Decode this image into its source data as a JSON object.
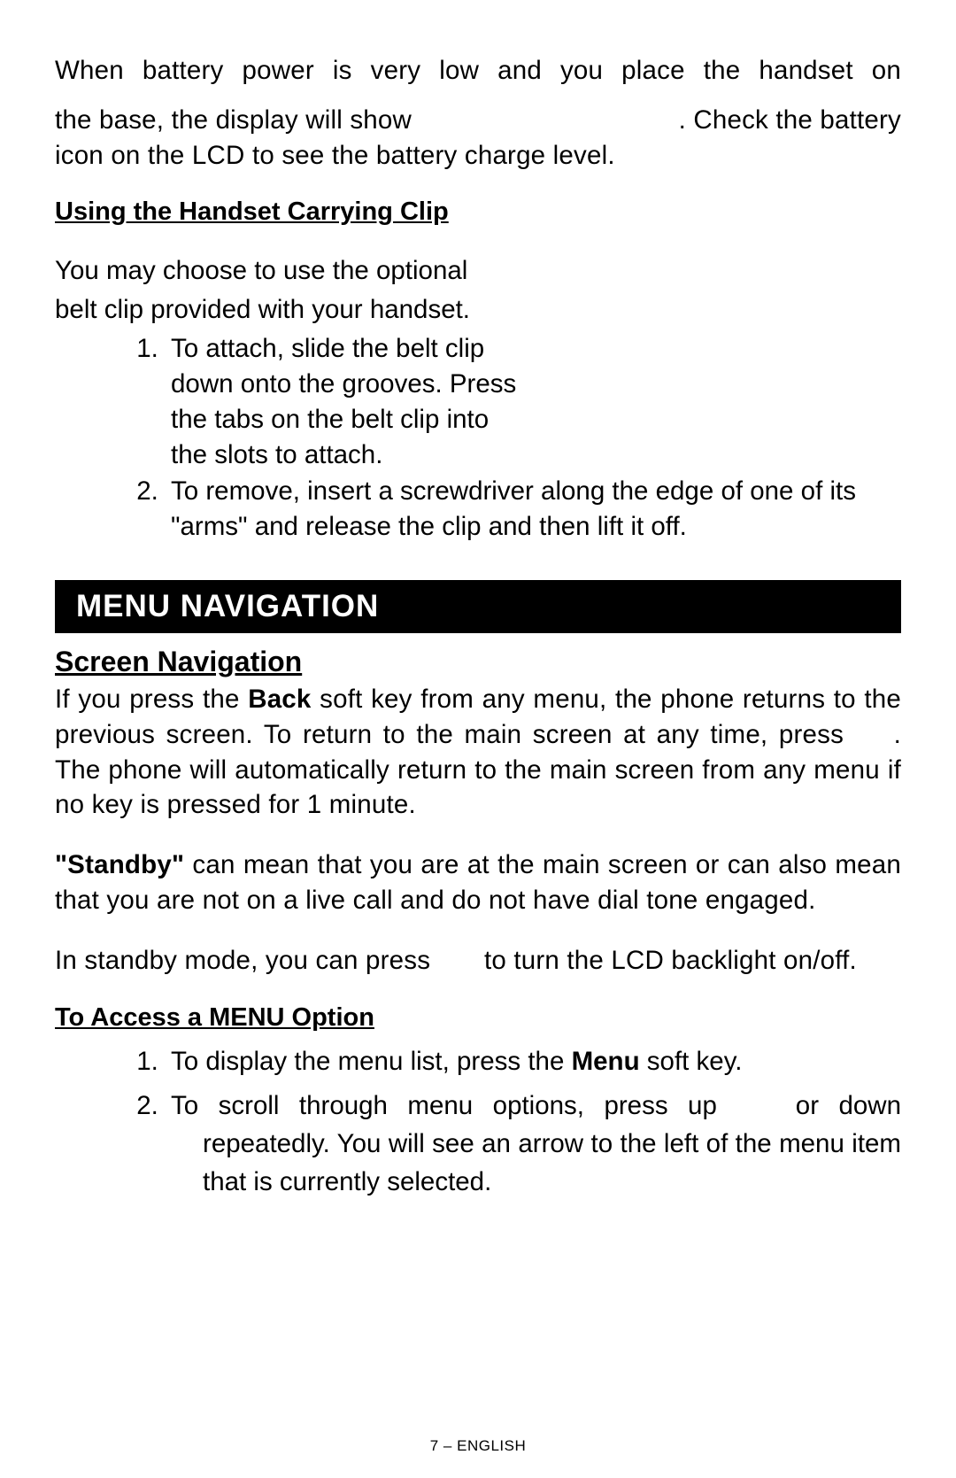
{
  "intro": {
    "line1": "When battery power is very low and you place the handset on",
    "line2a": "the base, the display will show ",
    "line2b": ".  Check the battery",
    "line3": "icon on the LCD to see the battery charge level."
  },
  "clip": {
    "heading": "Using the Handset Carrying Clip",
    "intro1": "You may choose to use the optional",
    "intro2": "belt clip provided with your handset.",
    "items": [
      "To attach, slide the belt clip down onto the grooves.  Press the tabs on the belt clip into the slots to attach.",
      "To remove, insert a screwdriver along the edge of one of its \"arms\" and release the clip and then lift it off."
    ]
  },
  "menunav": {
    "bar": "MENU NAVIGATION",
    "screen_heading": "Screen Navigation",
    "p1a": "If you press the ",
    "p1b": "Back",
    "p1c": " soft key from any menu, the phone returns to the previous screen.  To return to the main screen at any time, press ",
    "p1d": ".  The phone will automatically return to the main screen from any menu if no key is pressed for 1 minute.",
    "p2a": "\"Standby\"",
    "p2b": " can mean that you are at the main screen or can also also mean that you are not on a live call and do not have dial tone engaged.",
    "p2b_fixed": " can mean that you are at the main screen or can also mean that you are not on a live call and do not have dial tone engaged.",
    "p3a": "In standby mode, you can press ",
    "p3b": " to turn the LCD backlight on/off.",
    "access_heading": "To Access a MENU Option",
    "access": {
      "i1a": "To display the menu list, press the ",
      "i1b": "Menu",
      "i1c": " soft key.",
      "i2a": "To scroll through menu options, press up ",
      "i2b": " or down ",
      "i2c": " repeatedly.  You will see an arrow to the left of the menu item that is currently selected."
    }
  },
  "footer": "7 – ENGLISH"
}
